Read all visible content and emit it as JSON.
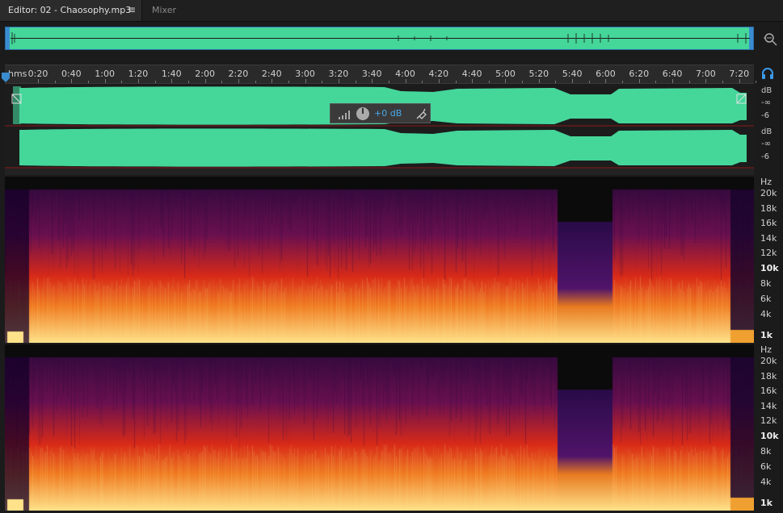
{
  "tabs": {
    "editor_label": "Editor: 02 - Chaosophy.mp3",
    "menu_glyph": "≡",
    "mixer_label": "Mixer"
  },
  "ruler": {
    "unit_label": "hms",
    "ticks": [
      "0:20",
      "0:40",
      "1:00",
      "1:20",
      "1:40",
      "2:00",
      "2:20",
      "2:40",
      "3:00",
      "3:20",
      "3:40",
      "4:00",
      "4:20",
      "4:40",
      "5:00",
      "5:20",
      "5:40",
      "6:00",
      "6:20",
      "6:40",
      "7:00",
      "7:20"
    ]
  },
  "hud": {
    "volume_label": "+0 dB"
  },
  "amplitude_scale": {
    "unit": "dB",
    "inf": "-∞",
    "neg6": "-6"
  },
  "frequency_scale": {
    "unit": "Hz",
    "labels": [
      "20k",
      "18k",
      "16k",
      "14k",
      "12k",
      "10k",
      "8k",
      "6k",
      "4k",
      "1k"
    ]
  },
  "colors": {
    "waveform": "#45d69a",
    "accent": "#3a8cd0",
    "spectral_low": "#ffe082",
    "spectral_mid": "#e8321a",
    "spectral_high": "#3c0f4a"
  }
}
